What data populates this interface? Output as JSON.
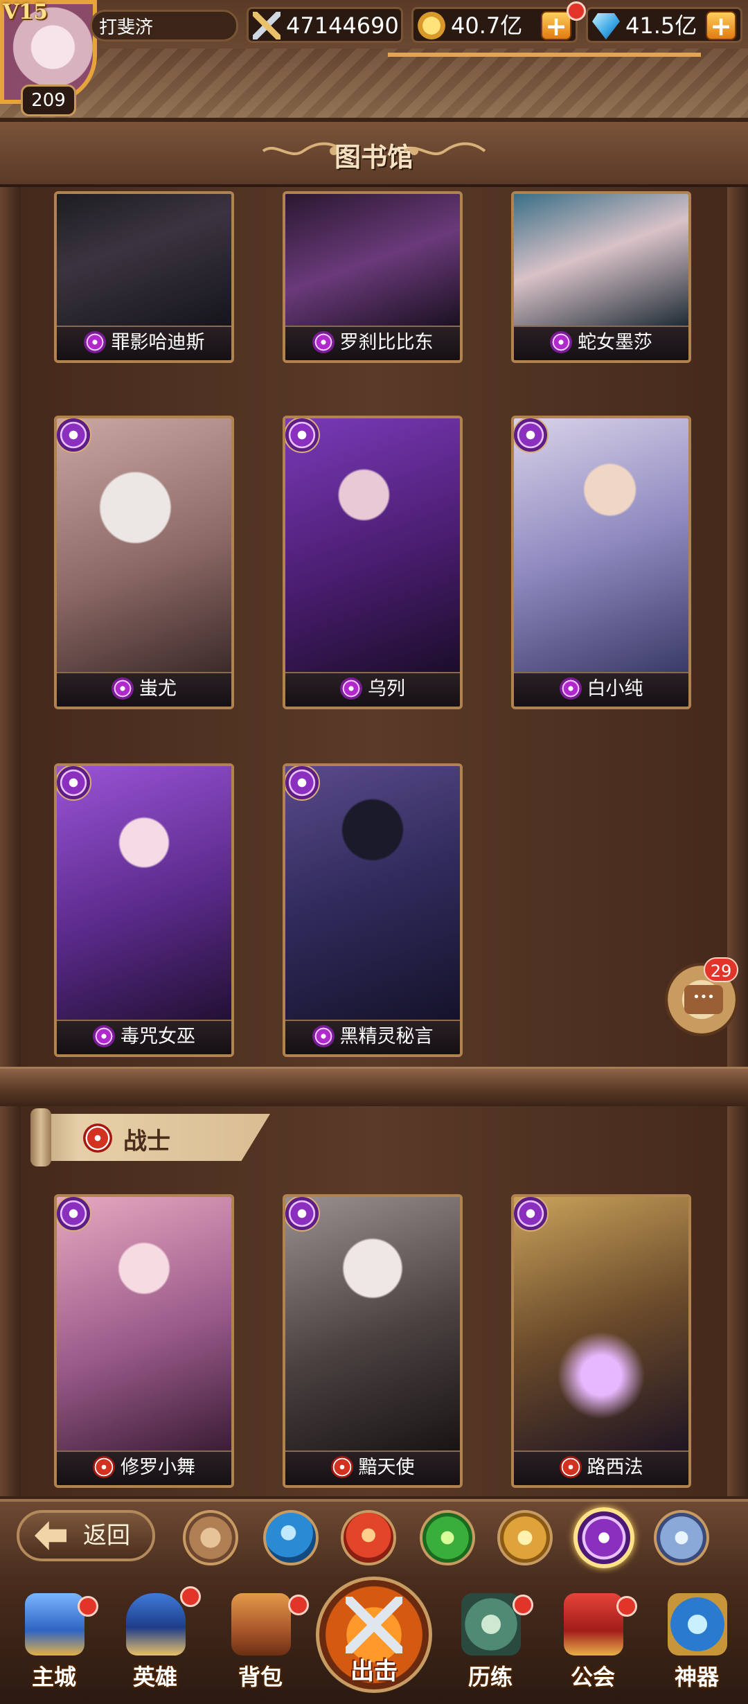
{
  "header": {
    "vip": "V15",
    "level": "209",
    "player_name": "打斐济",
    "combat_power": "47144690",
    "gold": "40.7亿",
    "diamonds": "41.5亿",
    "energy_progress": 1.0,
    "colors": {
      "accent": "#e6a43a",
      "badge": "#e2352a"
    }
  },
  "page": {
    "title": "图书馆"
  },
  "heroes_top": [
    {
      "name": "罪影哈迪斯",
      "faction_icon": "purple-swirl-icon"
    },
    {
      "name": "罗刹比比东",
      "faction_icon": "purple-swirl-icon"
    },
    {
      "name": "蛇女墨莎",
      "faction_icon": "purple-swirl-icon"
    },
    {
      "name": "蚩尤",
      "faction_icon": "purple-swirl-icon"
    },
    {
      "name": "乌列",
      "faction_icon": "purple-swirl-icon"
    },
    {
      "name": "白小纯",
      "faction_icon": "purple-swirl-icon"
    },
    {
      "name": "毒咒女巫",
      "faction_icon": "purple-swirl-icon"
    },
    {
      "name": "黑精灵秘言",
      "faction_icon": "purple-swirl-icon"
    }
  ],
  "warrior_section": {
    "label": "战士",
    "heroes": [
      {
        "name": "修罗小舞",
        "faction_icon": "red-blade-icon"
      },
      {
        "name": "黯天使",
        "faction_icon": "red-blade-icon"
      },
      {
        "name": "路西法",
        "faction_icon": "red-blade-icon"
      }
    ]
  },
  "chat": {
    "badge": "29"
  },
  "filter_bar": {
    "back_label": "返回",
    "filters": [
      "all-grid-icon",
      "water-drop-icon",
      "fire-icon",
      "wind-icon",
      "light-sun-icon",
      "dark-eye-icon",
      "void-prism-icon"
    ],
    "selected": "dark-eye-icon"
  },
  "nav": {
    "items": [
      {
        "label": "主城",
        "icon": "castle-icon"
      },
      {
        "label": "英雄",
        "icon": "helmet-icon"
      },
      {
        "label": "背包",
        "icon": "backpack-icon"
      },
      {
        "label": "出击",
        "icon": "crossed-swords-icon"
      },
      {
        "label": "历练",
        "icon": "training-icon"
      },
      {
        "label": "公会",
        "icon": "guild-banner-icon"
      },
      {
        "label": "神器",
        "icon": "artifact-icon"
      }
    ]
  }
}
